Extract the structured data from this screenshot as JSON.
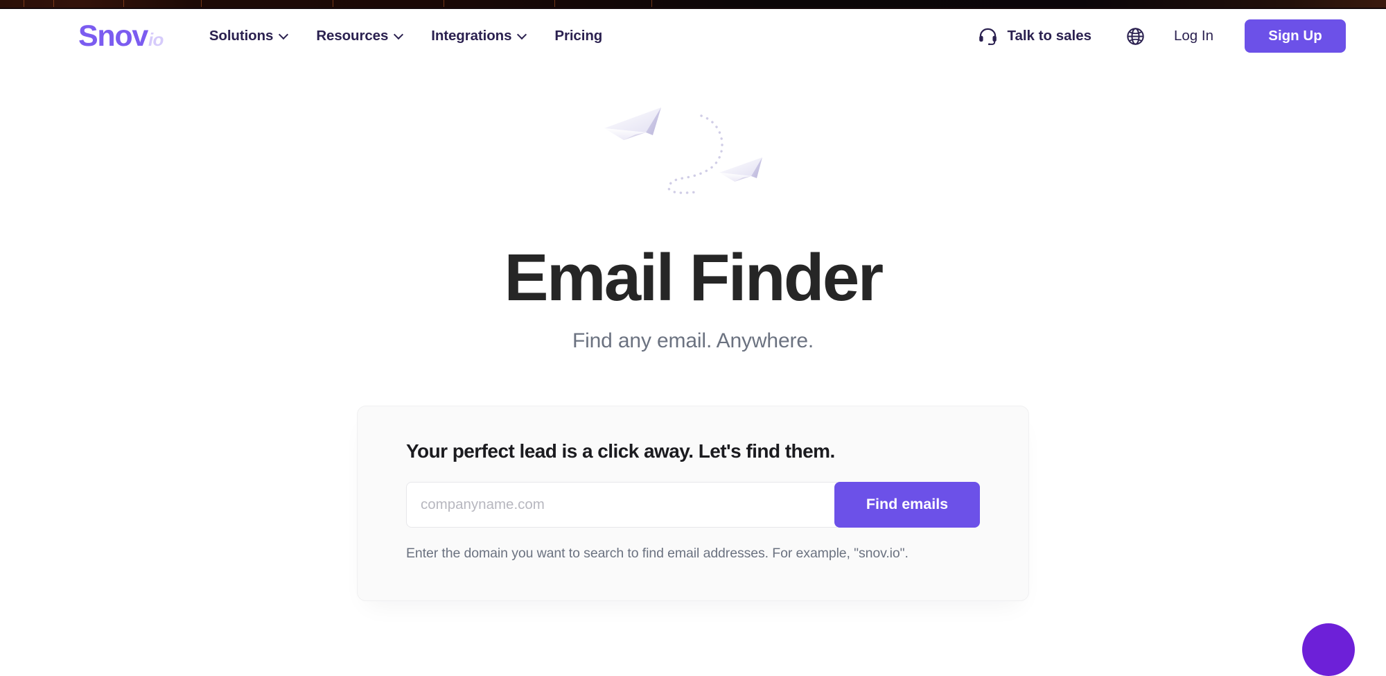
{
  "browser_strip": {
    "name": "residual-browser-chrome"
  },
  "header": {
    "logo": {
      "main": "Snov",
      "suffix": "io"
    },
    "nav": [
      {
        "label": "Solutions",
        "has_dropdown": true,
        "icon": "chevron-down-icon"
      },
      {
        "label": "Resources",
        "has_dropdown": true,
        "icon": "chevron-down-icon"
      },
      {
        "label": "Integrations",
        "has_dropdown": true,
        "icon": "chevron-down-icon"
      },
      {
        "label": "Pricing",
        "has_dropdown": false,
        "icon": ""
      }
    ],
    "talk_to_sales": {
      "label": "Talk to sales",
      "icon": "headset-icon"
    },
    "language": {
      "icon": "globe-icon"
    },
    "login_label": "Log In",
    "signup_label": "Sign Up"
  },
  "hero": {
    "illustration": "paper-planes-illustration",
    "title": "Email Finder",
    "subtitle": "Find any email. Anywhere."
  },
  "search_card": {
    "title": "Your perfect lead is a click away. Let's find them.",
    "input": {
      "value": "",
      "placeholder": "companyname.com"
    },
    "submit_label": "Find emails",
    "hint": "Enter the domain you want to search to find email addresses. For example, \"snov.io\"."
  },
  "chat_widget": {
    "name": "chat-launcher"
  },
  "colors": {
    "brand_purple": "#6c51e8",
    "logo_purple": "#7b5cf0",
    "logo_purple_light": "#d6cbfb",
    "nav_text": "#2b2150",
    "heading_dark": "#262626",
    "muted_text": "#6b7280",
    "card_bg": "#fafafa",
    "card_border": "#f0f0f1",
    "input_border": "#e7e7ea",
    "placeholder": "#b7b7bf",
    "chat_purple": "#6d20d8"
  }
}
